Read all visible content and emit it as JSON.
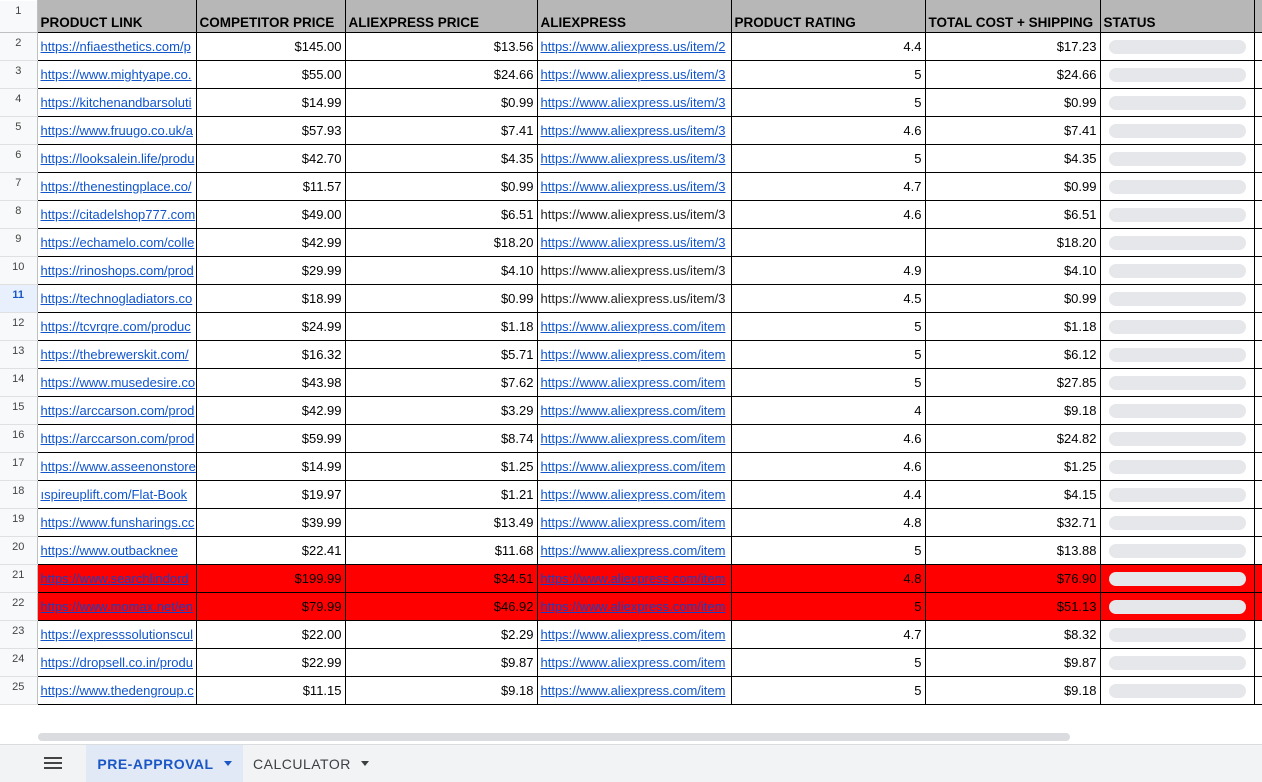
{
  "headers": [
    "PRODUCT LINK",
    "COMPETITOR PRICE",
    "ALIEXPRESS PRICE",
    "ALIEXPRESS",
    "PRODUCT RATING",
    "TOTAL COST + SHIPPING",
    "STATUS"
  ],
  "header_row_number": "1",
  "selected_row": "11",
  "highlight_color": "#ff0000",
  "rows": [
    {
      "n": "2",
      "link": "https://nfiaesthetics.com/p",
      "comp": "$145.00",
      "ali": "$13.56",
      "ali_link": "https://www.aliexpress.us/item/2",
      "ali_link_style": "link",
      "rating": "4.4",
      "total": "$17.23",
      "highlight": false
    },
    {
      "n": "3",
      "link": "https://www.mightyape.co.",
      "comp": "$55.00",
      "ali": "$24.66",
      "ali_link": "https://www.aliexpress.us/item/3",
      "ali_link_style": "link",
      "rating": "5",
      "total": "$24.66",
      "highlight": false
    },
    {
      "n": "4",
      "link": "https://kitchenandbarsoluti",
      "comp": "$14.99",
      "ali": "$0.99",
      "ali_link": "https://www.aliexpress.us/item/3",
      "ali_link_style": "link",
      "rating": "5",
      "total": "$0.99",
      "highlight": false
    },
    {
      "n": "5",
      "link": "https://www.fruugo.co.uk/a",
      "comp": "$57.93",
      "ali": "$7.41",
      "ali_link": "https://www.aliexpress.us/item/3",
      "ali_link_style": "link",
      "rating": "4.6",
      "total": "$7.41",
      "highlight": false
    },
    {
      "n": "6",
      "link": "https://looksalein.life/produ",
      "comp": "$42.70",
      "ali": "$4.35",
      "ali_link": "https://www.aliexpress.us/item/3",
      "ali_link_style": "link",
      "rating": "5",
      "total": "$4.35",
      "highlight": false
    },
    {
      "n": "7",
      "link": "https://thenestingplace.co/",
      "comp": "$11.57",
      "ali": "$0.99",
      "ali_link": "https://www.aliexpress.us/item/3",
      "ali_link_style": "link",
      "rating": "4.7",
      "total": "$0.99",
      "highlight": false
    },
    {
      "n": "8",
      "link": "https://citadelshop777.com",
      "comp": "$49.00",
      "ali": "$6.51",
      "ali_link": "https://www.aliexpress.us/item/3",
      "ali_link_style": "plain",
      "rating": "4.6",
      "total": "$6.51",
      "highlight": false
    },
    {
      "n": "9",
      "link": "https://echamelo.com/colle",
      "comp": "$42.99",
      "ali": "$18.20",
      "ali_link": "https://www.aliexpress.us/item/3",
      "ali_link_style": "link",
      "rating": "",
      "total": "$18.20",
      "highlight": false
    },
    {
      "n": "10",
      "link": "https://rinoshops.com/prod",
      "comp": "$29.99",
      "ali": "$4.10",
      "ali_link": "https://www.aliexpress.us/item/3",
      "ali_link_style": "plain",
      "rating": "4.9",
      "total": "$4.10",
      "highlight": false
    },
    {
      "n": "11",
      "link": "https://technogladiators.co",
      "comp": "$18.99",
      "ali": "$0.99",
      "ali_link": "https://www.aliexpress.us/item/3",
      "ali_link_style": "plain",
      "rating": "4.5",
      "total": "$0.99",
      "highlight": false
    },
    {
      "n": "12",
      "link": "https://tcvrqre.com/produc",
      "comp": "$24.99",
      "ali": "$1.18",
      "ali_link": "https://www.aliexpress.com/item",
      "ali_link_style": "link",
      "rating": "5",
      "total": "$1.18",
      "highlight": false
    },
    {
      "n": "13",
      "link": "https://thebrewerskit.com/",
      "comp": "$16.32",
      "ali": "$5.71",
      "ali_link": "https://www.aliexpress.com/item",
      "ali_link_style": "link",
      "rating": "5",
      "total": "$6.12",
      "highlight": false
    },
    {
      "n": "14",
      "link": "https://www.musedesire.co",
      "comp": "$43.98",
      "ali": "$7.62",
      "ali_link": "https://www.aliexpress.com/item",
      "ali_link_style": "link",
      "rating": "5",
      "total": "$27.85",
      "highlight": false
    },
    {
      "n": "15",
      "link": "https://arccarson.com/prod",
      "comp": "$42.99",
      "ali": "$3.29",
      "ali_link": "https://www.aliexpress.com/item",
      "ali_link_style": "link",
      "rating": "4",
      "total": "$9.18",
      "highlight": false
    },
    {
      "n": "16",
      "link": "https://arccarson.com/prod",
      "comp": "$59.99",
      "ali": "$8.74",
      "ali_link": "https://www.aliexpress.com/item",
      "ali_link_style": "link",
      "rating": "4.6",
      "total": "$24.82",
      "highlight": false
    },
    {
      "n": "17",
      "link": "https://www.asseenonstore",
      "comp": "$14.99",
      "ali": "$1.25",
      "ali_link": "https://www.aliexpress.com/item",
      "ali_link_style": "link",
      "rating": "4.6",
      "total": "$1.25",
      "highlight": false
    },
    {
      "n": "18",
      "link": "ıspireuplift.com/Flat-Book",
      "comp": "$19.97",
      "ali": "$1.21",
      "ali_link": "https://www.aliexpress.com/item",
      "ali_link_style": "link",
      "rating": "4.4",
      "total": "$4.15",
      "highlight": false
    },
    {
      "n": "19",
      "link": "https://www.funsharings.cc",
      "comp": "$39.99",
      "ali": "$13.49",
      "ali_link": "https://www.aliexpress.com/item",
      "ali_link_style": "link",
      "rating": "4.8",
      "total": "$32.71",
      "highlight": false
    },
    {
      "n": "20",
      "link": "https://www.outbacknee",
      "comp": "$22.41",
      "ali": "$11.68",
      "ali_link": "https://www.aliexpress.com/item",
      "ali_link_style": "link",
      "rating": "5",
      "total": "$13.88",
      "highlight": false
    },
    {
      "n": "21",
      "link": "https://www.searchlindord",
      "comp": "$199.99",
      "ali": "$34.51",
      "ali_link": "https://www.aliexpress.com/item",
      "ali_link_style": "link",
      "rating": "4.8",
      "total": "$76.90",
      "highlight": true
    },
    {
      "n": "22",
      "link": "https://www.momax.net/en",
      "comp": "$79.99",
      "ali": "$46.92",
      "ali_link": "https://www.aliexpress.com/item",
      "ali_link_style": "link",
      "rating": "5",
      "total": "$51.13",
      "highlight": true
    },
    {
      "n": "23",
      "link": "https://expresssolutionscul",
      "comp": "$22.00",
      "ali": "$2.29",
      "ali_link": "https://www.aliexpress.com/item",
      "ali_link_style": "link",
      "rating": "4.7",
      "total": "$8.32",
      "highlight": false
    },
    {
      "n": "24",
      "link": "https://dropsell.co.in/produ",
      "comp": "$22.99",
      "ali": "$9.87",
      "ali_link": "https://www.aliexpress.com/item",
      "ali_link_style": "link",
      "rating": "5",
      "total": "$9.87",
      "highlight": false
    },
    {
      "n": "25",
      "link": "https://www.thedengroup.c",
      "comp": "$11.15",
      "ali": "$9.18",
      "ali_link": "https://www.aliexpress.com/item",
      "ali_link_style": "link",
      "rating": "5",
      "total": "$9.18",
      "highlight": false
    }
  ],
  "sheet_tabs": [
    {
      "label": "PRE-APPROVAL",
      "active": true
    },
    {
      "label": "CALCULATOR",
      "active": false
    }
  ],
  "icons": {
    "menu": "all-sheets-menu-icon",
    "caret": "caret-down-icon"
  }
}
